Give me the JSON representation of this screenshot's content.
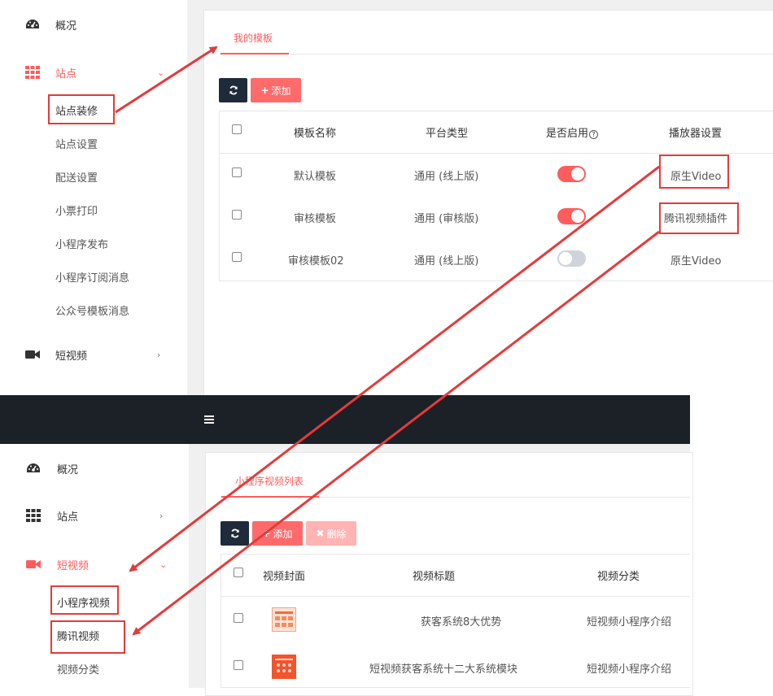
{
  "top": {
    "sidebar": {
      "overview": "概况",
      "site": "站点",
      "site_sub": [
        "站点装修",
        "站点设置",
        "配送设置",
        "小票打印",
        "小程序发布",
        "小程序订阅消息",
        "公众号模板消息"
      ],
      "short_video": "短视频"
    },
    "tab": "我的模板",
    "add_button": "添加",
    "table": {
      "headers": [
        "模板名称",
        "平台类型",
        "是否启用",
        "播放器设置"
      ],
      "rows": [
        {
          "name": "默认模板",
          "platform": "通用 (线上版)",
          "enabled": true,
          "player": "原生Video"
        },
        {
          "name": "审核模板",
          "platform": "通用 (审核版)",
          "enabled": true,
          "player": "腾讯视频插件"
        },
        {
          "name": "审核模板02",
          "platform": "通用 (线上版)",
          "enabled": false,
          "player": "原生Video"
        }
      ]
    }
  },
  "bottom": {
    "sidebar": {
      "overview": "概况",
      "site": "站点",
      "short_video": "短视频",
      "video_sub": [
        "小程序视频",
        "腾讯视频",
        "视频分类"
      ]
    },
    "tab": "小程序视频列表",
    "add_button": "添加",
    "delete_button": "删除",
    "table": {
      "headers": [
        "视频封面",
        "视频标题",
        "视频分类"
      ],
      "rows": [
        {
          "title": "获客系统8大优势",
          "category": "短视频小程序介绍"
        },
        {
          "title": "短视频获客系统十二大系统模块",
          "category": "短视频小程序介绍"
        }
      ]
    }
  },
  "colors": {
    "accent": "#ff5c5c",
    "annotation": "#e53a3a",
    "dark": "#1c2027"
  }
}
